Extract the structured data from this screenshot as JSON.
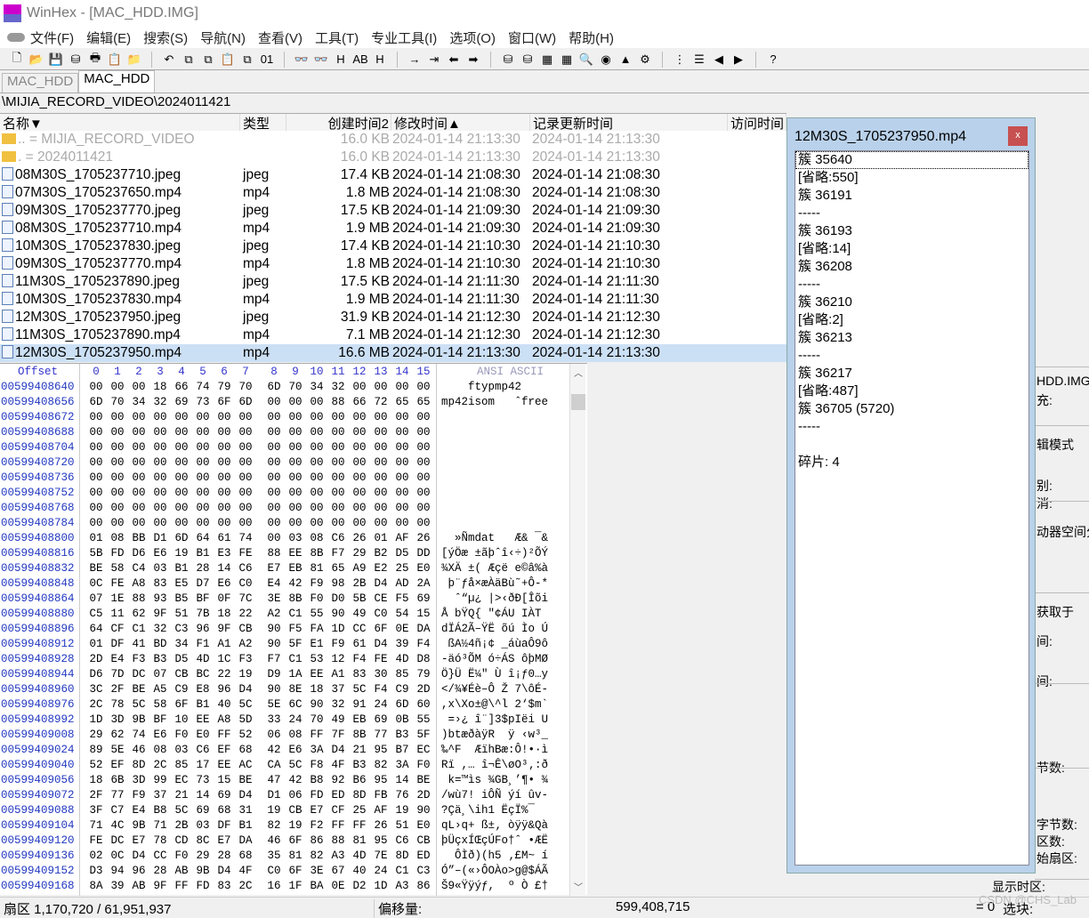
{
  "window": {
    "title": "WinHex - [MAC_HDD.IMG]",
    "logo": "HEX"
  },
  "menu": [
    "文件(F)",
    "编辑(E)",
    "搜索(S)",
    "导航(N)",
    "查看(V)",
    "工具(T)",
    "专业工具(I)",
    "选项(O)",
    "窗口(W)",
    "帮助(H)"
  ],
  "toolbar": [
    "new-file-icon",
    "open-file-icon",
    "save-icon",
    "save-as-icon",
    "print-icon",
    "properties-icon",
    "open-folder-icon",
    "|",
    "undo-icon",
    "copy-icon",
    "copy-block-icon",
    "paste-icon",
    "paste-block-icon",
    "binary-icon",
    "|",
    "find-icon",
    "find-text-icon",
    "find-hex-icon",
    "replace-text-icon",
    "replace-hex-icon",
    "|",
    "goto-icon",
    "goto-offset-icon",
    "back-icon",
    "forward-icon",
    "|",
    "open-disk-icon",
    "clone-disk-icon",
    "ram-icon",
    "calculator-icon",
    "analyze-icon",
    "snapshot-icon",
    "image-icon",
    "tools-icon",
    "|",
    "tree-icon",
    "list-icon",
    "prev-icon",
    "next-icon",
    "|",
    "help-icon"
  ],
  "toolbar_glyphs": {
    "new-file-icon": "🗋",
    "open-file-icon": "📂",
    "save-icon": "💾",
    "save-as-icon": "⛁",
    "print-icon": "🖶",
    "properties-icon": "📋",
    "open-folder-icon": "📁",
    "undo-icon": "↶",
    "copy-icon": "⧉",
    "copy-block-icon": "⧉",
    "paste-icon": "📋",
    "paste-block-icon": "⧉",
    "binary-icon": "01",
    "find-icon": "👓",
    "find-text-icon": "👓",
    "find-hex-icon": "H",
    "replace-text-icon": "AB",
    "replace-hex-icon": "H",
    "goto-icon": "→",
    "goto-offset-icon": "⇥",
    "back-icon": "⬅",
    "forward-icon": "➡",
    "open-disk-icon": "⛁",
    "clone-disk-icon": "⛁",
    "ram-icon": "▦",
    "calculator-icon": "▦",
    "analyze-icon": "🔍",
    "snapshot-icon": "◉",
    "image-icon": "▲",
    "tools-icon": "⚙",
    "tree-icon": "⋮",
    "list-icon": "☰",
    "prev-icon": "◀",
    "next-icon": "▶",
    "help-icon": "?"
  },
  "tabs": [
    {
      "label": "MAC_HDD",
      "active": false
    },
    {
      "label": "MAC_HDD",
      "active": true
    }
  ],
  "path": "\\MIJIA_RECORD_VIDEO\\2024011421",
  "file_list": {
    "columns": [
      "名称▼",
      "类型",
      "创建时间2",
      "修改时间▲",
      "记录更新时间",
      "访问时间"
    ],
    "rows": [
      {
        "name": "..  =  MIJIA_RECORD_VIDEO",
        "type": "",
        "size": "16.0 KB",
        "modified": "2024-01-14  21:13:30",
        "record": "2024-01-14  21:13:30",
        "folder": true
      },
      {
        "name": ".  =  2024011421",
        "type": "",
        "size": "16.0 KB",
        "modified": "2024-01-14  21:13:30",
        "record": "2024-01-14  21:13:30",
        "folder": true
      },
      {
        "name": "08M30S_1705237710.jpeg",
        "type": "jpeg",
        "size": "17.4 KB",
        "modified": "2024-01-14  21:08:30",
        "record": "2024-01-14  21:08:30"
      },
      {
        "name": "07M30S_1705237650.mp4",
        "type": "mp4",
        "size": "1.8 MB",
        "modified": "2024-01-14  21:08:30",
        "record": "2024-01-14  21:08:30"
      },
      {
        "name": "09M30S_1705237770.jpeg",
        "type": "jpeg",
        "size": "17.5 KB",
        "modified": "2024-01-14  21:09:30",
        "record": "2024-01-14  21:09:30"
      },
      {
        "name": "08M30S_1705237710.mp4",
        "type": "mp4",
        "size": "1.9 MB",
        "modified": "2024-01-14  21:09:30",
        "record": "2024-01-14  21:09:30"
      },
      {
        "name": "10M30S_1705237830.jpeg",
        "type": "jpeg",
        "size": "17.4 KB",
        "modified": "2024-01-14  21:10:30",
        "record": "2024-01-14  21:10:30"
      },
      {
        "name": "09M30S_1705237770.mp4",
        "type": "mp4",
        "size": "1.8 MB",
        "modified": "2024-01-14  21:10:30",
        "record": "2024-01-14  21:10:30"
      },
      {
        "name": "11M30S_1705237890.jpeg",
        "type": "jpeg",
        "size": "17.5 KB",
        "modified": "2024-01-14  21:11:30",
        "record": "2024-01-14  21:11:30"
      },
      {
        "name": "10M30S_1705237830.mp4",
        "type": "mp4",
        "size": "1.9 MB",
        "modified": "2024-01-14  21:11:30",
        "record": "2024-01-14  21:11:30"
      },
      {
        "name": "12M30S_1705237950.jpeg",
        "type": "jpeg",
        "size": "31.9 KB",
        "modified": "2024-01-14  21:12:30",
        "record": "2024-01-14  21:12:30"
      },
      {
        "name": "11M30S_1705237890.mp4",
        "type": "mp4",
        "size": "7.1 MB",
        "modified": "2024-01-14  21:12:30",
        "record": "2024-01-14  21:12:30"
      },
      {
        "name": "12M30S_1705237950.mp4",
        "type": "mp4",
        "size": "16.6 MB",
        "modified": "2024-01-14  21:13:30",
        "record": "2024-01-14  21:13:30",
        "selected": true
      }
    ]
  },
  "hex": {
    "offset_label": "Offset",
    "charset_label": "ANSI ASCII",
    "columns": [
      "0",
      "1",
      "2",
      "3",
      "4",
      "5",
      "6",
      "7",
      "8",
      "9",
      "10",
      "11",
      "12",
      "13",
      "14",
      "15"
    ],
    "rows": [
      [
        "00599408640",
        "00 00 00 18 66 74 79 70 6D 70 34 32 00 00 00 00",
        "    ftypmp42"
      ],
      [
        "00599408656",
        "6D 70 34 32 69 73 6F 6D 00 00 00 88 66 72 65 65",
        "mp42isom   ˆfree"
      ],
      [
        "00599408672",
        "00 00 00 00 00 00 00 00 00 00 00 00 00 00 00 00",
        ""
      ],
      [
        "00599408688",
        "00 00 00 00 00 00 00 00 00 00 00 00 00 00 00 00",
        ""
      ],
      [
        "00599408704",
        "00 00 00 00 00 00 00 00 00 00 00 00 00 00 00 00",
        ""
      ],
      [
        "00599408720",
        "00 00 00 00 00 00 00 00 00 00 00 00 00 00 00 00",
        ""
      ],
      [
        "00599408736",
        "00 00 00 00 00 00 00 00 00 00 00 00 00 00 00 00",
        ""
      ],
      [
        "00599408752",
        "00 00 00 00 00 00 00 00 00 00 00 00 00 00 00 00",
        ""
      ],
      [
        "00599408768",
        "00 00 00 00 00 00 00 00 00 00 00 00 00 00 00 00",
        ""
      ],
      [
        "00599408784",
        "00 00 00 00 00 00 00 00 00 00 00 00 00 00 00 00",
        ""
      ],
      [
        "00599408800",
        "01 08 BB D1 6D 64 61 74 00 03 08 C6 26 01 AF 26",
        "  »Ñmdat   Æ& ¯&"
      ],
      [
        "00599408816",
        "5B FD D6 E6 19 B1 E3 FE 88 EE 8B F7 29 B2 D5 DD",
        "[ýÖæ ±ãþˆî‹÷)²ÕÝ"
      ],
      [
        "00599408832",
        "BE 58 C4 03 B1 28 14 C6 E7 EB 81 65 A9 E2 25 E0",
        "¾XÄ ±( Æçë e©â%à"
      ],
      [
        "00599408848",
        "0C FE A8 83 E5 D7 E6 C0 E4 42 F9 98 2B D4 AD 2A",
        " þ¨ƒå×æÀäBù˜+Ô-*"
      ],
      [
        "00599408864",
        "07 1E 88 93 B5 BF 0F 7C 3E 8B F0 D0 5B CE F5 69",
        "  ˆ“µ¿ |>‹ðÐ[Îõi"
      ],
      [
        "00599408880",
        "C5 11 62 9F 51 7B 18 22 A2 C1 55 90 49 C0 54 15",
        "Å bŸQ{ \"¢ÁU IÀT "
      ],
      [
        "00599408896",
        "64 CF C1 32 C3 96 9F CB 90 F5 FA 1D CC 6F 0E DA",
        "dÏÁ2Ã–ŸË õú Ìo Ú"
      ],
      [
        "00599408912",
        "01 DF 41 BD 34 F1 A1 A2 90 5F E1 F9 61 D4 39 F4",
        " ßA½4ñ¡¢ _áùaÔ9ô"
      ],
      [
        "00599408928",
        "2D E4 F3 B3 D5 4D 1C F3 F7 C1 53 12 F4 FE 4D D8",
        "-äó³ÕM ó÷ÁS ôþMØ"
      ],
      [
        "00599408944",
        "D6 7D DC 07 CB BC 22 19 D9 1A EE A1 83 30 85 79",
        "Ö}Ü Ë¼\" Ù î¡ƒ0…y"
      ],
      [
        "00599408960",
        "3C 2F BE A5 C9 E8 96 D4 90 8E 18 37 5C F4 C9 2D",
        "</¾¥Éè–Ô Ž 7\\ôÉ-"
      ],
      [
        "00599408976",
        "2C 78 5C 58 6F B1 40 5C 5E 6C 90 32 91 24 6D 60",
        ",x\\Xo±@\\^l 2‘$m`"
      ],
      [
        "00599408992",
        "1D 3D 9B BF 10 EE A8 5D 33 24 70 49 EB 69 0B 55",
        " =›¿ î¨]3$pIëi U"
      ],
      [
        "00599409008",
        "29 62 74 E6 F0 E0 FF 52 06 08 FF 7F 8B 77 B3 5F",
        ")btæðàÿR  ÿ ‹w³_"
      ],
      [
        "00599409024",
        "89 5E 46 08 03 C6 EF 68 42 E6 3A D4 21 95 B7 EC",
        "‰^F  ÆïhBæ:Ô!•·ì"
      ],
      [
        "00599409040",
        "52 EF 8D 2C 85 17 EE AC CA 5C F8 4F B3 82 3A F0",
        "Rï ,… î¬Ê\\øO³‚:ð"
      ],
      [
        "00599409056",
        "18 6B 3D 99 EC 73 15 BE 47 42 B8 92 B6 95 14 BE",
        " k=™ìs ¾GB¸’¶• ¾"
      ],
      [
        "00599409072",
        "2F 77 F9 37 21 14 69 D4 D1 06 FD ED 8D FB 76 2D",
        "/wù7! iÔÑ ýí ûv-"
      ],
      [
        "00599409088",
        "3F C7 E4 B8 5C 69 68 31 19 CB E7 CF 25 AF 19 90",
        "?Çä¸\\ih1 ËçÏ%¯  "
      ],
      [
        "00599409104",
        "71 4C 9B 71 2B 03 DF B1 82 19 F2 FF FF 26 51 E0",
        "qL›q+ ß±‚ òÿÿ&Qà"
      ],
      [
        "00599409120",
        "FE DC E7 78 CD 8C E7 DA 46 6F 86 88 81 95 C6 CB",
        "þÜçxÍŒçÚFo†ˆ •ÆË"
      ],
      [
        "00599409136",
        "02 0C D4 CC F0 29 28 68 35 81 82 A3 4D 7E 8D ED",
        "  ÔÌð)(h5 ‚£M~ í"
      ],
      [
        "00599409152",
        "D3 94 96 28 AB 9B D4 4F C0 6F 3E 67 40 24 C1 C3",
        "Ó”–(«›ÔOÀo>g@$ÁÃ"
      ],
      [
        "00599409168",
        "8A 39 AB 9F FF FD 83 2C 16 1F BA 0E D2 1D A3 86",
        "Š9«Ÿÿýƒ,  º Ò £†"
      ]
    ]
  },
  "popup": {
    "title": "12M30S_1705237950.mp4",
    "close": "x",
    "items": [
      "簇 35640",
      "[省略:550]",
      "簇 36191",
      "-----",
      "簇 36193",
      "[省略:14]",
      "簇 36208",
      "-----",
      "簇 36210",
      "[省略:2]",
      "簇 36213",
      "-----",
      "簇 36217",
      "[省略:487]",
      "簇 36705 (5720)",
      "-----",
      "",
      "碎片: 4"
    ]
  },
  "info_panel": [
    "HDD.IMG",
    "充:",
    "辑模式",
    "别:",
    "消:",
    "动器空间分",
    "获取于",
    "间:",
    "间:",
    "节数:",
    "字节数:",
    "区数:",
    "始扇区:"
  ],
  "info_panel_timezone": "显示时区:",
  "status": {
    "sector": "扇区 1,170,720 / 61,951,937",
    "offset_label": "偏移量:",
    "offset_value": "599,408,715",
    "eq": "= 0",
    "selection": "选块:"
  },
  "watermark": "CSDN @CHS_Lab"
}
